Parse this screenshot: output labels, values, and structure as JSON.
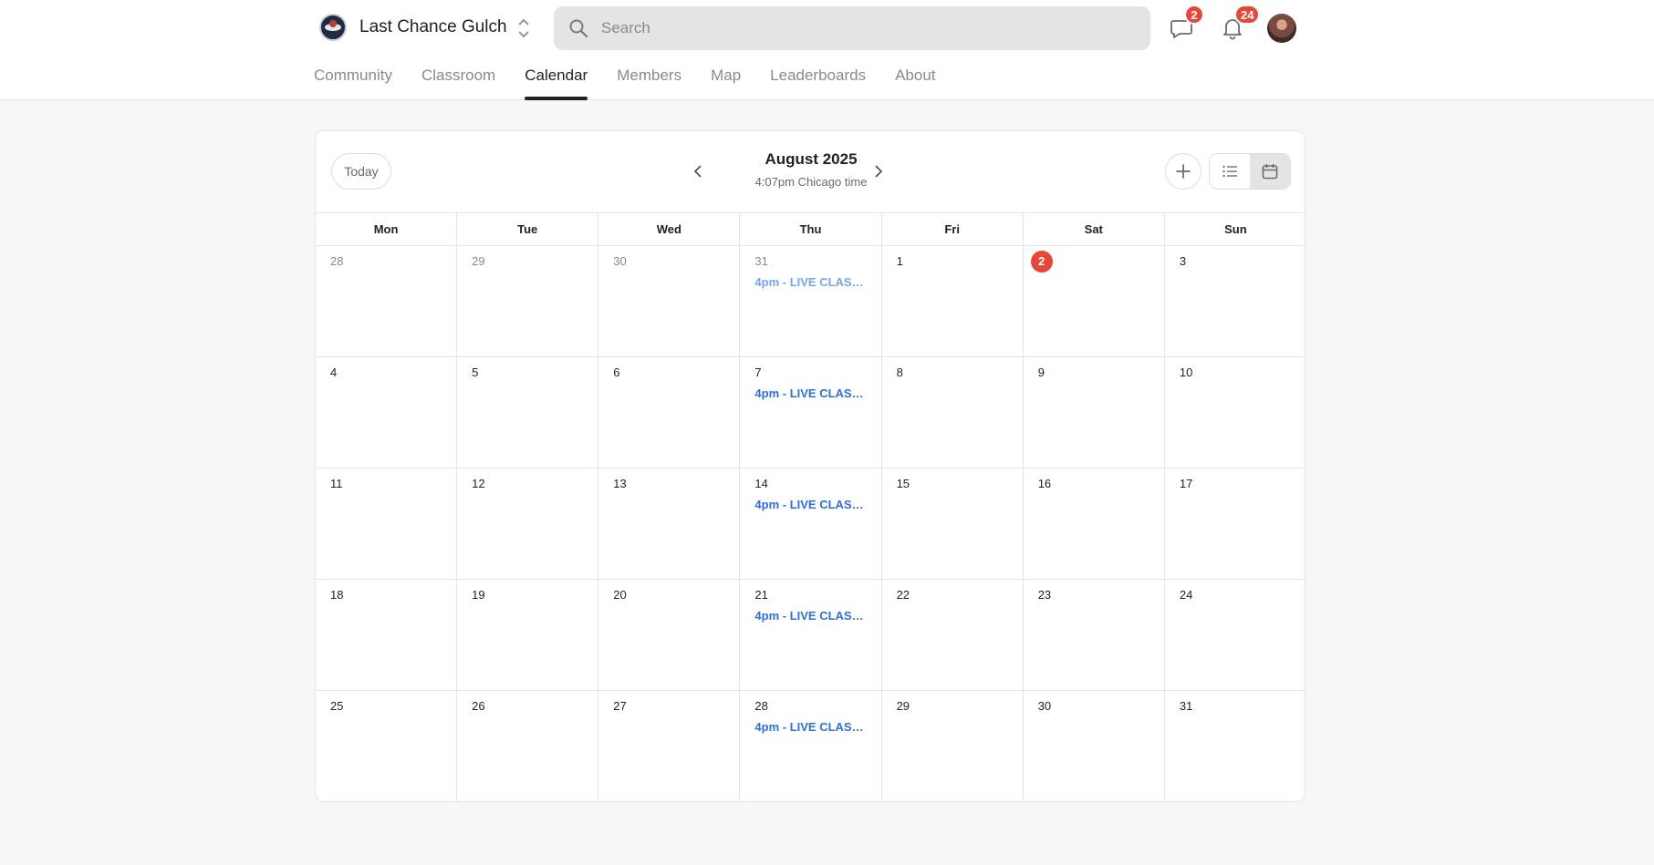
{
  "header": {
    "community_name": "Last Chance Gulch",
    "search_placeholder": "Search",
    "chat_badge": "2",
    "notification_badge": "24"
  },
  "nav": {
    "tabs": [
      {
        "label": "Community",
        "active": false
      },
      {
        "label": "Classroom",
        "active": false
      },
      {
        "label": "Calendar",
        "active": true
      },
      {
        "label": "Members",
        "active": false
      },
      {
        "label": "Map",
        "active": false
      },
      {
        "label": "Leaderboards",
        "active": false
      },
      {
        "label": "About",
        "active": false
      }
    ]
  },
  "calendar": {
    "today_label": "Today",
    "month_title": "August 2025",
    "time_note": "4:07pm Chicago time",
    "weekdays": [
      "Mon",
      "Tue",
      "Wed",
      "Thu",
      "Fri",
      "Sat",
      "Sun"
    ],
    "days": [
      {
        "n": "28",
        "muted": true
      },
      {
        "n": "29",
        "muted": true
      },
      {
        "n": "30",
        "muted": true
      },
      {
        "n": "31",
        "muted": true,
        "event": "4pm - LIVE CLASS ..."
      },
      {
        "n": "1"
      },
      {
        "n": "2",
        "today": true
      },
      {
        "n": "3"
      },
      {
        "n": "4"
      },
      {
        "n": "5"
      },
      {
        "n": "6"
      },
      {
        "n": "7",
        "event": "4pm - LIVE CLASS ..."
      },
      {
        "n": "8"
      },
      {
        "n": "9"
      },
      {
        "n": "10"
      },
      {
        "n": "11"
      },
      {
        "n": "12"
      },
      {
        "n": "13"
      },
      {
        "n": "14",
        "event": "4pm - LIVE CLASS ..."
      },
      {
        "n": "15"
      },
      {
        "n": "16"
      },
      {
        "n": "17"
      },
      {
        "n": "18"
      },
      {
        "n": "19"
      },
      {
        "n": "20"
      },
      {
        "n": "21",
        "event": "4pm - LIVE CLASS ..."
      },
      {
        "n": "22"
      },
      {
        "n": "23"
      },
      {
        "n": "24"
      },
      {
        "n": "25"
      },
      {
        "n": "26"
      },
      {
        "n": "27"
      },
      {
        "n": "28",
        "event": "4pm - LIVE CLASS ..."
      },
      {
        "n": "29"
      },
      {
        "n": "30"
      },
      {
        "n": "31"
      }
    ]
  },
  "colors": {
    "badge": "#e5483b",
    "event": "#2f6fd6",
    "active_tab": "#202124"
  },
  "icons": [
    "community-logo-icon",
    "switcher-chevrons-icon",
    "search-icon",
    "chat-icon",
    "bell-icon",
    "chevron-left-icon",
    "chevron-right-icon",
    "plus-icon",
    "list-view-icon",
    "calendar-view-icon"
  ]
}
